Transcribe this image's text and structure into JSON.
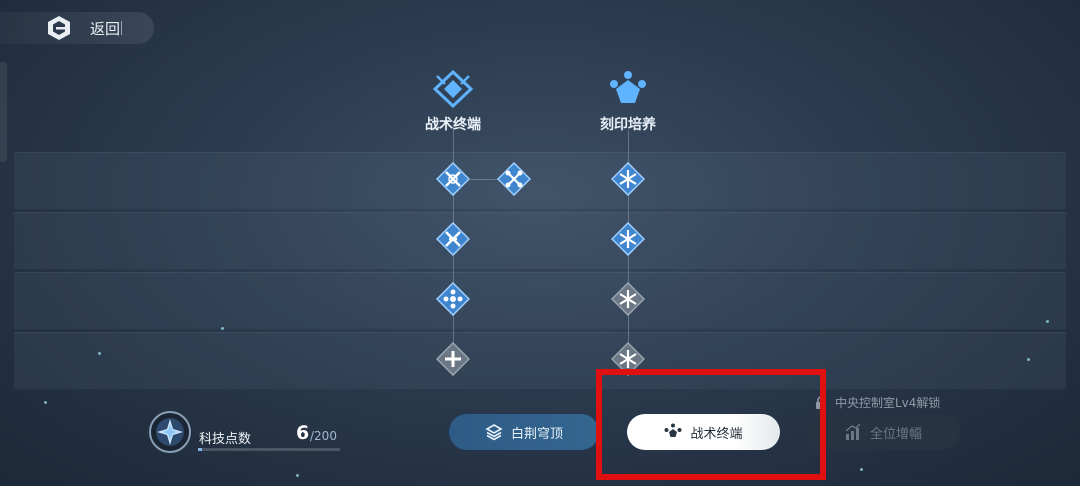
{
  "header": {
    "back_label": "返回"
  },
  "columns": [
    {
      "title": "战术终端",
      "icon": "tactical-terminal-icon"
    },
    {
      "title": "刻印培养",
      "icon": "imprint-training-icon"
    }
  ],
  "tech_points": {
    "label": "科技点数",
    "current": "6",
    "max": "/200",
    "fill_fraction": 0.03
  },
  "tabs": [
    {
      "label": "白荆穹顶",
      "icon": "layers-icon",
      "state": "default"
    },
    {
      "label": "战术终端",
      "icon": "nodes-icon",
      "state": "selected"
    },
    {
      "label": "全位增幅",
      "icon": "chart-up-icon",
      "state": "locked"
    }
  ],
  "lock_note": "中央控制室Lv4解锁",
  "colors": {
    "accent": "#3a86d6",
    "node_active": "#3f86cf",
    "node_inactive": "#6b7785",
    "highlight": "#e11010"
  }
}
